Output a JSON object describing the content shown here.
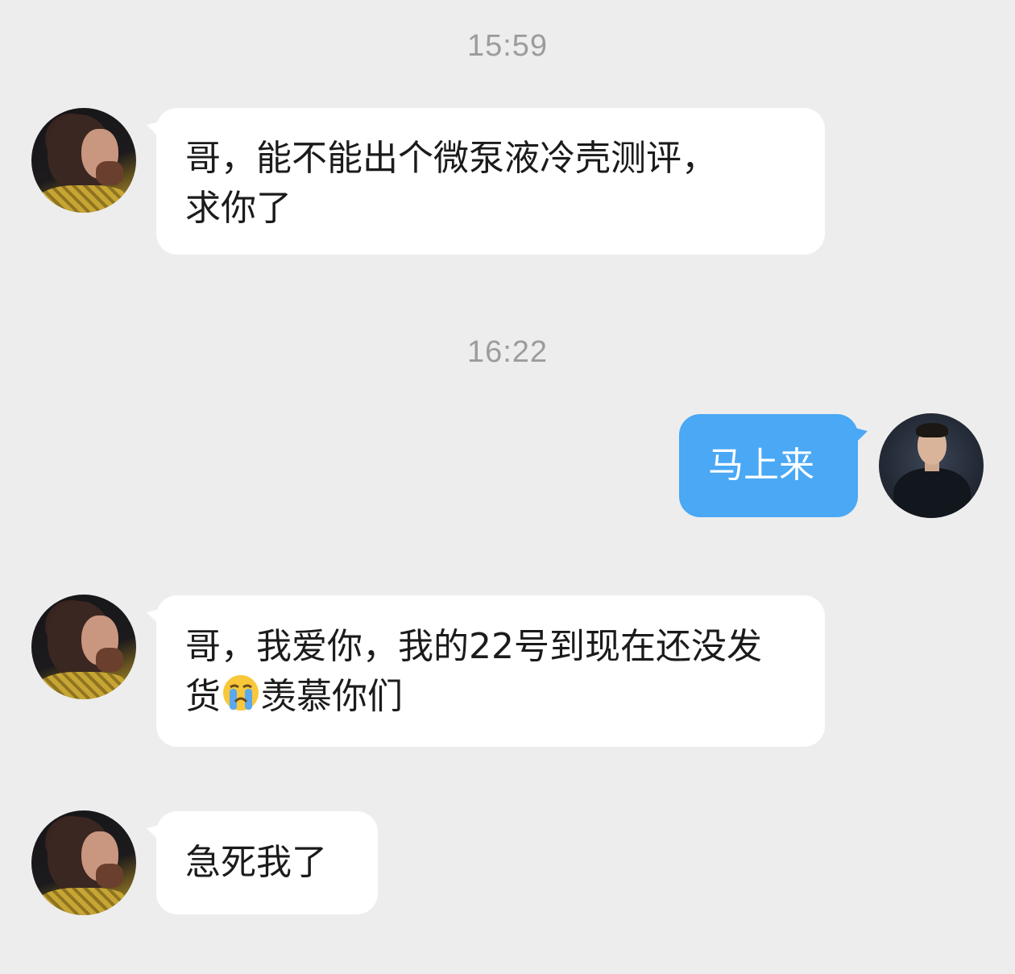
{
  "timestamps": [
    "15:59",
    "16:22"
  ],
  "messages": [
    {
      "sender": "contact",
      "text": "哥，能不能出个微泵液冷壳测评，求你了"
    },
    {
      "sender": "self",
      "text": "马上来"
    },
    {
      "sender": "contact",
      "text_before_emoji": "哥，我爱你，我的22号到现在还没发货",
      "emoji": "crying-face",
      "text_after_emoji": "羡慕你们"
    },
    {
      "sender": "contact",
      "text": "急死我了"
    }
  ],
  "colors": {
    "background": "#ededed",
    "incoming_bubble": "#ffffff",
    "outgoing_bubble": "#4aa8f5",
    "timestamp_text": "#9c9c9c"
  }
}
